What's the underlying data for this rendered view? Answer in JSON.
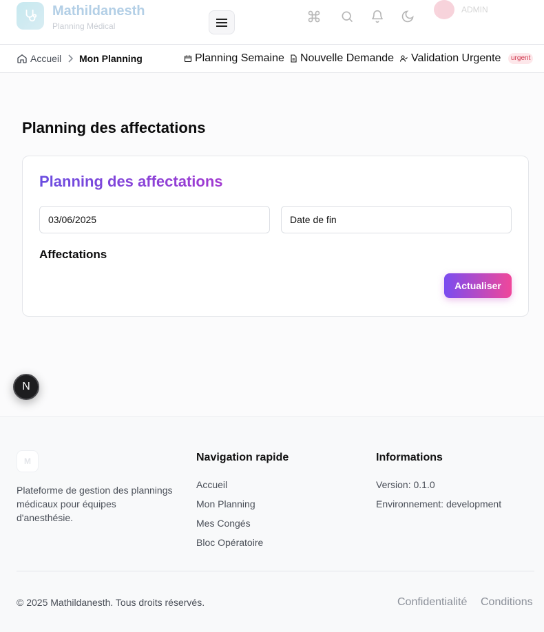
{
  "header": {
    "app_name": "Mathildanesth",
    "app_subtitle": "Planning Médical",
    "user_name": "ADMIN"
  },
  "breadcrumb": {
    "home": "Accueil",
    "current": "Mon Planning"
  },
  "quick_links": {
    "week": "Planning Semaine",
    "request": "Nouvelle Demande",
    "urgent": "Validation Urgente",
    "urgent_badge": "urgent"
  },
  "main": {
    "page_title": "Planning des affectations",
    "card_title": "Planning des affectations",
    "start_date_value": "03/06/2025",
    "end_date_placeholder": "Date de fin",
    "section_title": "Affectations",
    "refresh_label": "Actualiser"
  },
  "dev_badge": "N",
  "footer": {
    "logo_letter": "M",
    "description": "Plateforme de gestion des plannings médicaux pour équipes d'anesthésie.",
    "nav_title": "Navigation rapide",
    "nav_links": [
      "Accueil",
      "Mon Planning",
      "Mes Congés",
      "Bloc Opératoire"
    ],
    "info_title": "Informations",
    "version": "Version: 0.1.0",
    "environment": "Environnement: development",
    "copyright": "© 2025 Mathildanesth. Tous droits réservés.",
    "privacy": "Confidentialité",
    "terms": "Conditions"
  },
  "colors": {
    "accent_start": "#7a4cf0",
    "accent_end": "#f0479a",
    "title_gradient_start": "#6a4de0",
    "urgent_badge_bg": "#fde7ea",
    "urgent_badge_text": "#d0394f"
  }
}
